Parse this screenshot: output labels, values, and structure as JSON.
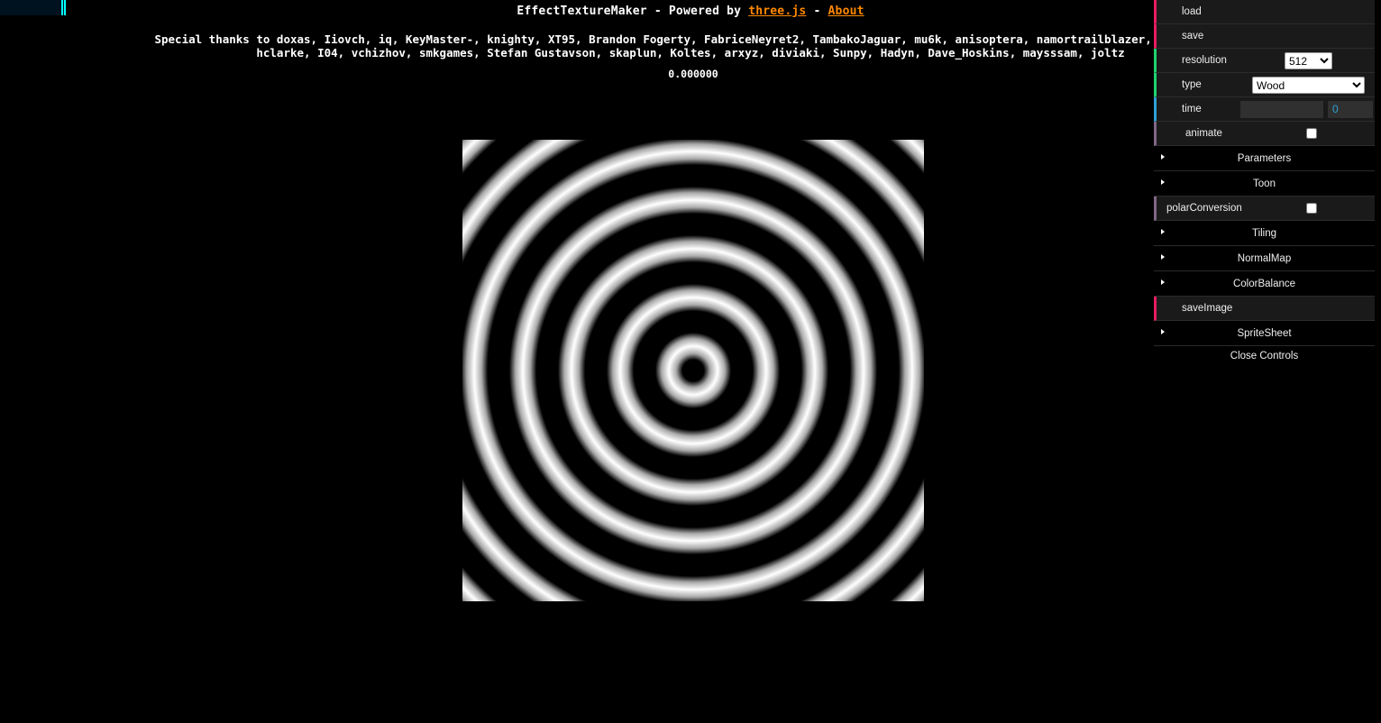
{
  "header": {
    "title_prefix": "EffectTextureMaker - Powered by ",
    "title_link": "three.js",
    "title_sep": " - ",
    "about_link": "About",
    "thanks_line1": "Special thanks to doxas, Iiovch, iq, KeyMaster-, knighty, XT95, Brandon Fogerty, FabriceNeyret2, TambakoJaguar, mu6k, anisoptera, namortrailblazer, vamoss, xb",
    "thanks_line2": "hclarke, I04, vchizhov, smkgames, Stefan Gustavson, skaplun, Koltes, arxyz, diviaki, Sunpy, Hadyn, Dave_Hoskins, maysssam, joltz",
    "timer": "0.000000"
  },
  "texture": {
    "type": "concentric-rings",
    "colors": {
      "dark": "#000000",
      "light": "#ffffff"
    }
  },
  "gui": {
    "load_label": "load",
    "save_label": "save",
    "resolution_label": "resolution",
    "resolution_value": "512",
    "type_label": "type",
    "type_value": "Wood",
    "time_label": "time",
    "time_value": "0",
    "animate_label": "animate",
    "animate_checked": false,
    "folders": {
      "parameters": "Parameters",
      "toon": "Toon",
      "tiling": "Tiling",
      "normalmap": "NormalMap",
      "colorbalance": "ColorBalance",
      "spritesheet": "SpriteSheet"
    },
    "polar_label": "polarConversion",
    "polar_checked": false,
    "saveimage_label": "saveImage",
    "close_label": "Close Controls"
  },
  "colors": {
    "link": "#ff8800",
    "stats_bar": "#00ffff",
    "function": "#e61d5f",
    "number": "#2fa1d6",
    "combo": "#1ed36f",
    "boolean": "#806787"
  },
  "icons": [
    "triangle-right-icon",
    "chevron-down-icon"
  ]
}
